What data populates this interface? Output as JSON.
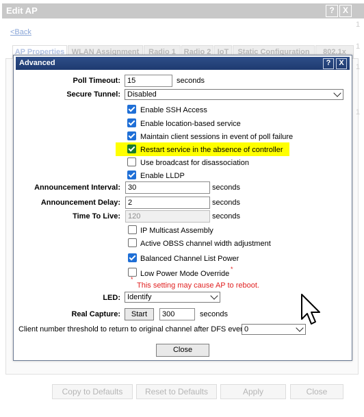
{
  "outer": {
    "title": "Edit AP",
    "help_btn": "?",
    "close_btn": "X",
    "back_link": "<Back",
    "tabs": [
      "AP Properties",
      "WLAN Assignment",
      "Radio 1",
      "Radio 2",
      "IoT",
      "Static Configuration",
      "802.1x"
    ],
    "side_numbers": [
      "1",
      "1",
      "1",
      "1"
    ],
    "bottom_buttons": {
      "copy": "Copy to Defaults",
      "reset": "Reset to Defaults",
      "apply": "Apply",
      "close": "Close"
    }
  },
  "advanced": {
    "title": "Advanced",
    "help_btn": "?",
    "close_btn": "X",
    "poll_timeout": {
      "label": "Poll Timeout:",
      "value": "15",
      "unit": "seconds"
    },
    "secure_tunnel": {
      "label": "Secure Tunnel:",
      "value": "Disabled"
    },
    "checkboxes": [
      {
        "label": "Enable SSH Access",
        "checked": true
      },
      {
        "label": "Enable location-based service",
        "checked": true
      },
      {
        "label": "Maintain client sessions in event of poll failure",
        "checked": true
      },
      {
        "label": "Restart service in the absence of controller",
        "checked": true
      },
      {
        "label": "Use broadcast for disassociation",
        "checked": false
      },
      {
        "label": "Enable LLDP",
        "checked": true
      }
    ],
    "announcement_interval": {
      "label": "Announcement Interval:",
      "value": "30",
      "unit": "seconds"
    },
    "announcement_delay": {
      "label": "Announcement Delay:",
      "value": "2",
      "unit": "seconds"
    },
    "time_to_live": {
      "label": "Time To Live:",
      "value": "120",
      "unit": "seconds"
    },
    "checkboxes2": [
      {
        "label": "IP Multicast Assembly",
        "checked": false
      },
      {
        "label": "Active OBSS channel width adjustment",
        "checked": false
      },
      {
        "label": "Balanced Channel List Power",
        "checked": true
      },
      {
        "label": "Low Power Mode Override",
        "checked": false
      }
    ],
    "low_power_asterisk": "*",
    "warning_asterisk": "*",
    "warning": "This setting may cause AP to reboot.",
    "led": {
      "label": "LED:",
      "value": "Identify"
    },
    "real_capture": {
      "label": "Real Capture:",
      "button": "Start",
      "value": "300",
      "unit": "seconds"
    },
    "client_threshold": {
      "label": "Client number threshold to return to original channel after DFS event",
      "value": "0"
    },
    "close_button": "Close"
  }
}
